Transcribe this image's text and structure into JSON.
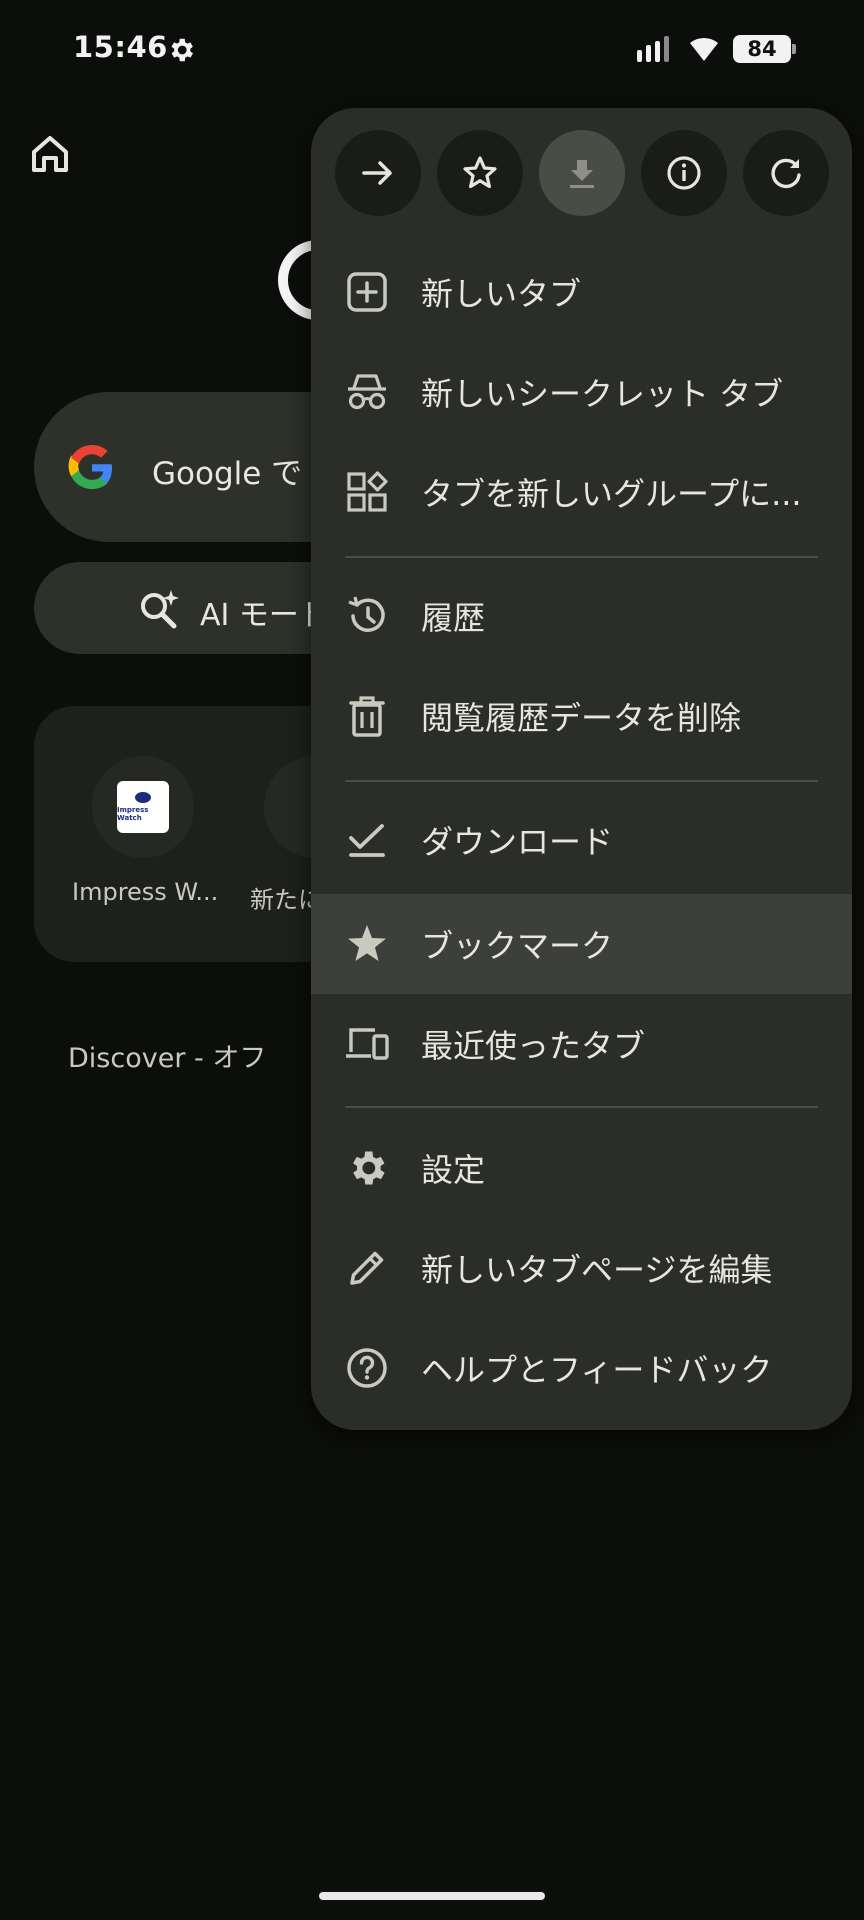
{
  "status_bar": {
    "time": "15:46",
    "battery": "84"
  },
  "background": {
    "search_placeholder": "Google で",
    "ai_mode_label": "AI モード",
    "shortcuts": [
      {
        "label": "Impress W...",
        "logo_text": "Impress Watch"
      },
      {
        "label": "新たに"
      }
    ],
    "discover_label": "Discover - オフ"
  },
  "menu": {
    "toolbar": [
      {
        "icon": "forward-icon",
        "enabled": true
      },
      {
        "icon": "star-outline-icon",
        "enabled": true
      },
      {
        "icon": "download-icon",
        "enabled": false
      },
      {
        "icon": "info-icon",
        "enabled": true
      },
      {
        "icon": "refresh-icon",
        "enabled": true
      }
    ],
    "items": [
      {
        "label": "新しいタブ",
        "icon": "new-tab-icon"
      },
      {
        "label": "新しいシークレット タブ",
        "icon": "incognito-icon"
      },
      {
        "label": "タブを新しいグループに...",
        "icon": "tab-group-icon"
      },
      {
        "label": "履歴",
        "icon": "history-icon"
      },
      {
        "label": "閲覧履歴データを削除",
        "icon": "trash-icon"
      },
      {
        "label": "ダウンロード",
        "icon": "downloads-icon"
      },
      {
        "label": "ブックマーク",
        "icon": "bookmark-star-icon",
        "highlighted": true
      },
      {
        "label": "最近使ったタブ",
        "icon": "devices-icon"
      },
      {
        "label": "設定",
        "icon": "settings-gear-icon"
      },
      {
        "label": "新しいタブページを編集",
        "icon": "pencil-icon"
      },
      {
        "label": "ヘルプとフィードバック",
        "icon": "help-icon"
      }
    ]
  },
  "colors": {
    "page_bg": "#0c0e0b",
    "menu_bg": "#2b2e28",
    "highlight_bg": "#3d403a",
    "icon": "#c8cabf"
  }
}
